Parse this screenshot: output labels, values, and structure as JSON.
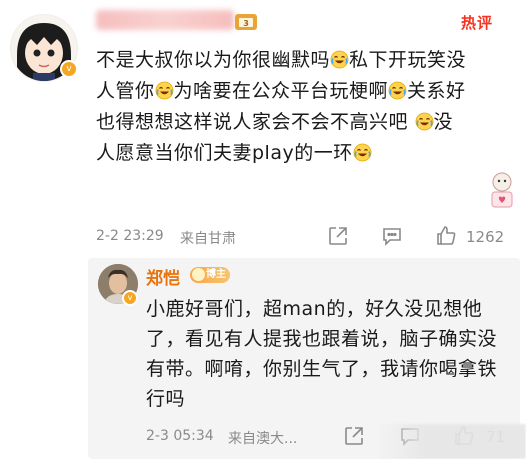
{
  "comment": {
    "hot_label": "热评",
    "segments": [
      {
        "t": "text",
        "v": "不是大叔你以为你很幽默吗"
      },
      {
        "t": "emoji",
        "v": "laugh-cry"
      },
      {
        "t": "text",
        "v": "私下开玩笑没人管你"
      },
      {
        "t": "emoji",
        "v": "laugh-cry"
      },
      {
        "t": "text",
        "v": "为啥要在公众平台玩梗啊"
      },
      {
        "t": "emoji",
        "v": "laugh-cry"
      },
      {
        "t": "text",
        "v": "关系好也得想想这样说人家会不会不高兴吧 "
      },
      {
        "t": "emoji",
        "v": "laugh-cry"
      },
      {
        "t": "text",
        "v": "没人愿意当你们夫妻play的一环"
      },
      {
        "t": "emoji",
        "v": "laugh-cry"
      }
    ],
    "time": "2-2 23:29",
    "location": "来自甘肃",
    "like_count": "1262"
  },
  "reply": {
    "author": "郑恺",
    "badge_label": "博主",
    "text": "小鹿好哥们，超man的，好久没见想他了，看见有人提我也跟着说，脑子确实没有带。啊唷，你别生气了，我请你喝拿铁行吗",
    "time": "2-3 05:34",
    "location": "来自澳大...",
    "like_count": "71"
  },
  "icons": {
    "share": "share-icon",
    "comment": "comment-icon",
    "like": "thumbs-up-icon",
    "verified": "v-badge-icon",
    "emoji": "laugh-cry-emoji-icon"
  },
  "colors": {
    "hot": "#f5331f",
    "author": "#e9730d",
    "badge": "#f9a54d",
    "verified": "#f5a623",
    "meta": "#8a8a8a",
    "reply_bg": "#f4f4f4"
  }
}
